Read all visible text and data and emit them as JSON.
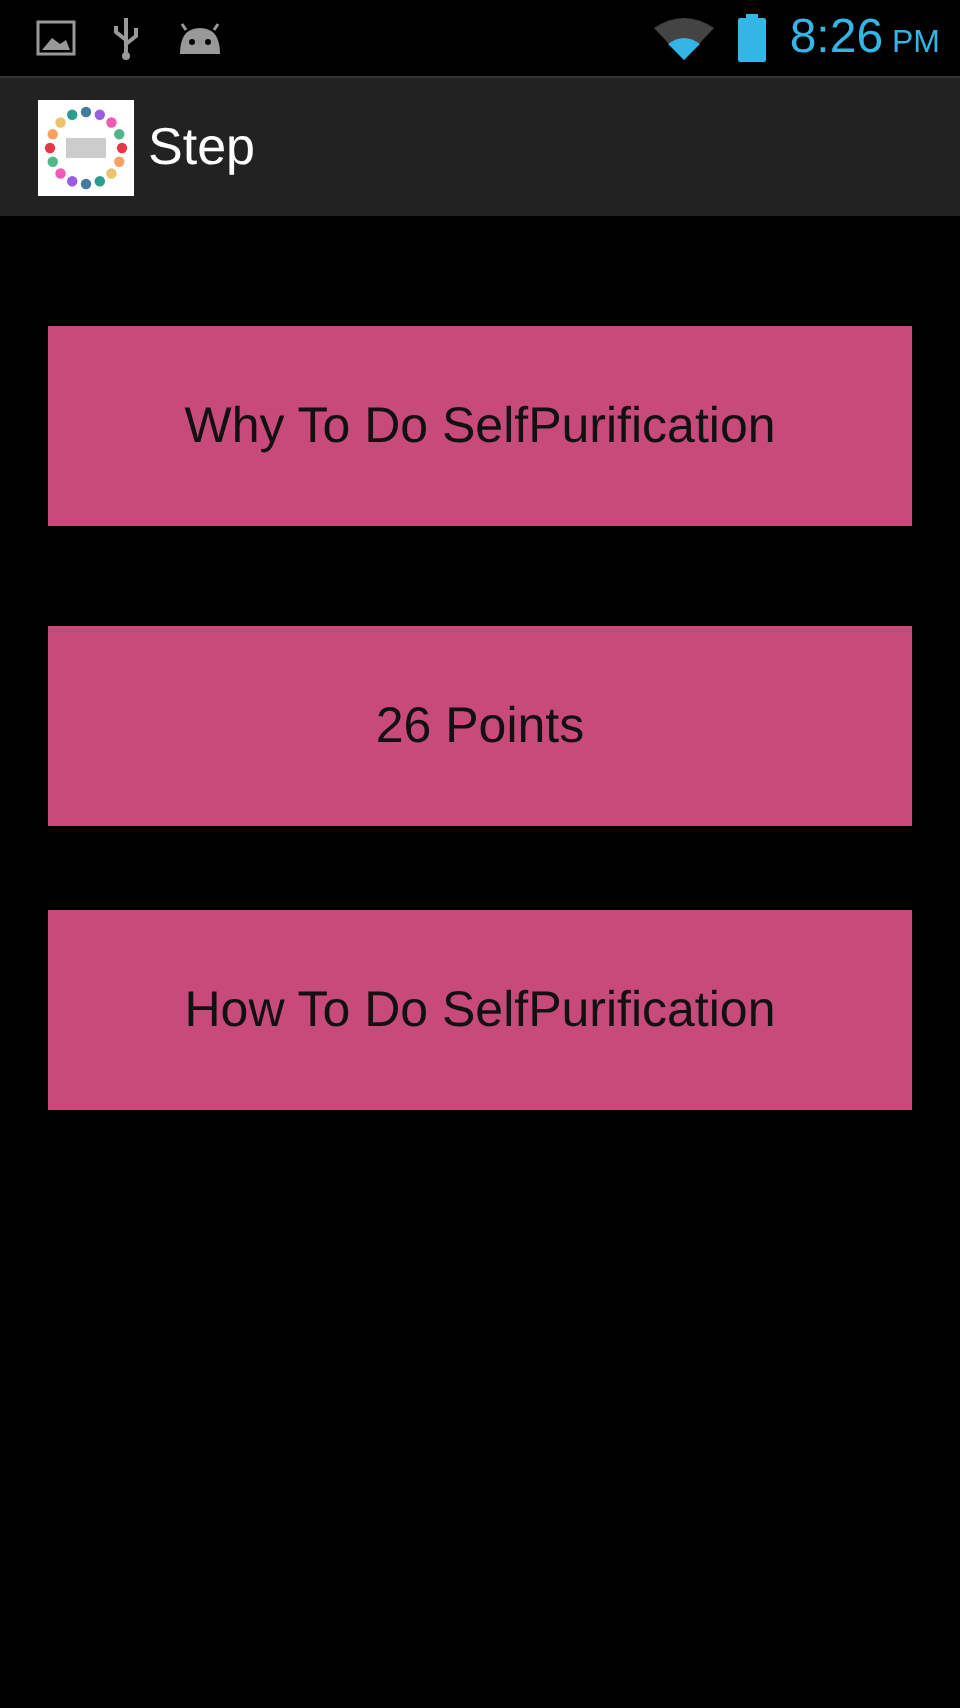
{
  "status_bar": {
    "time": "8:26",
    "meridiem": "PM"
  },
  "action_bar": {
    "title": "Step"
  },
  "buttons": [
    {
      "label": "Why To Do SelfPurification"
    },
    {
      "label": "26 Points"
    },
    {
      "label": "How To Do SelfPurification"
    }
  ]
}
